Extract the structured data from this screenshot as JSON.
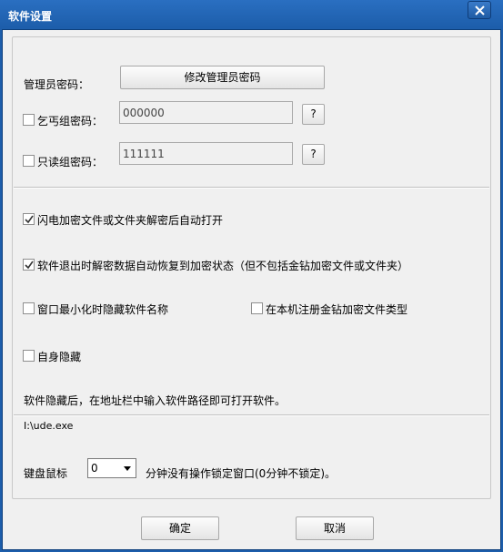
{
  "window": {
    "title": "软件设置"
  },
  "admin": {
    "label": "管理员密码：",
    "change_button": "修改管理员密码"
  },
  "beggar_group": {
    "label": "乞丐组密码：",
    "value": "000000",
    "help_button": "?"
  },
  "readonly_group": {
    "label": "只读组密码：",
    "value": "111111",
    "help_button": "?"
  },
  "options": {
    "auto_open": {
      "label": "闪电加密文件或文件夹解密后自动打开",
      "checked": true
    },
    "restore_on_exit": {
      "label": "软件退出时解密数据自动恢复到加密状态（但不包括金钻加密文件或文件夹）",
      "checked": true
    },
    "hide_name_minimized": {
      "label": "窗口最小化时隐藏软件名称",
      "checked": false
    },
    "register_type": {
      "label": "在本机注册金钻加密文件类型",
      "checked": false
    },
    "self_hide": {
      "label": "自身隐藏",
      "checked": false
    }
  },
  "hint": {
    "text": "软件隐藏后，在地址栏中输入软件路径即可打开软件。"
  },
  "path": {
    "value": "I:\\ude.exe"
  },
  "lock": {
    "label": "键盘鼠标",
    "minutes": "0",
    "suffix": "分钟没有操作锁定窗口(0分钟不锁定)。"
  },
  "footer": {
    "ok": "确定",
    "cancel": "取消"
  },
  "colors": {
    "title_bar": "#1d5eab",
    "client_bg": "#f0f0f0"
  }
}
